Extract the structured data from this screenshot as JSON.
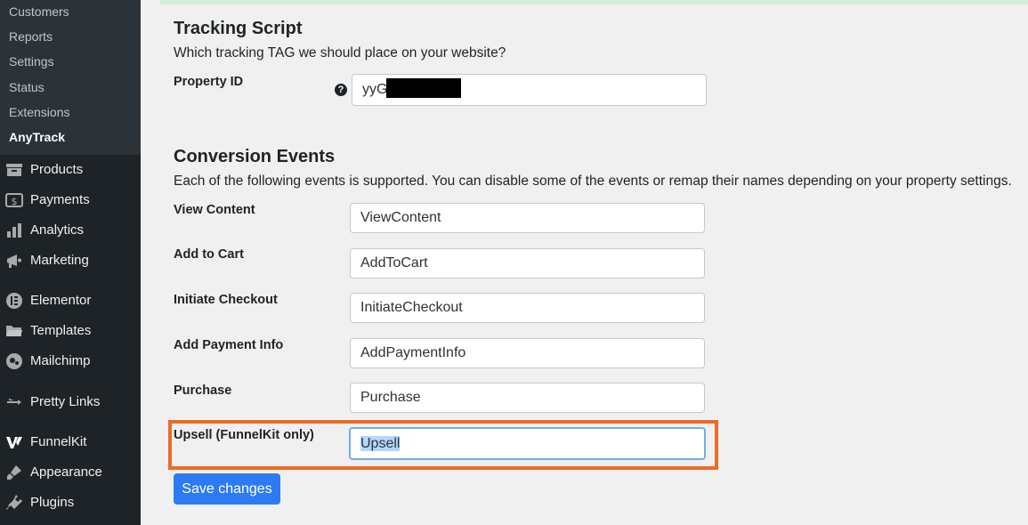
{
  "sidebar": {
    "submenu": [
      "Customers",
      "Reports",
      "Settings",
      "Status",
      "Extensions",
      "AnyTrack"
    ],
    "menu": [
      "Products",
      "Payments",
      "Analytics",
      "Marketing",
      "Elementor",
      "Templates",
      "Mailchimp",
      "Pretty Links",
      "FunnelKit",
      "Appearance",
      "Plugins"
    ]
  },
  "tracking": {
    "title": "Tracking Script",
    "description": "Which tracking TAG we should place on your website?",
    "property_label": "Property ID",
    "property_value": "yyG"
  },
  "conversion": {
    "title": "Conversion Events",
    "description": "Each of the following events is supported. You can disable some of the events or remap their names depending on your property settings.",
    "fields": [
      {
        "label": "View Content",
        "value": "ViewContent"
      },
      {
        "label": "Add to Cart",
        "value": "AddToCart"
      },
      {
        "label": "Initiate Checkout",
        "value": "InitiateCheckout"
      },
      {
        "label": "Add Payment Info",
        "value": "AddPaymentInfo"
      },
      {
        "label": "Purchase",
        "value": "Purchase"
      },
      {
        "label": "Upsell (FunnelKit only)",
        "value": "Upsell"
      }
    ]
  },
  "save_label": "Save changes",
  "colors": {
    "accent": "#2c7bf3",
    "highlight": "#ec6b25",
    "sidebar": "#1d2327"
  }
}
